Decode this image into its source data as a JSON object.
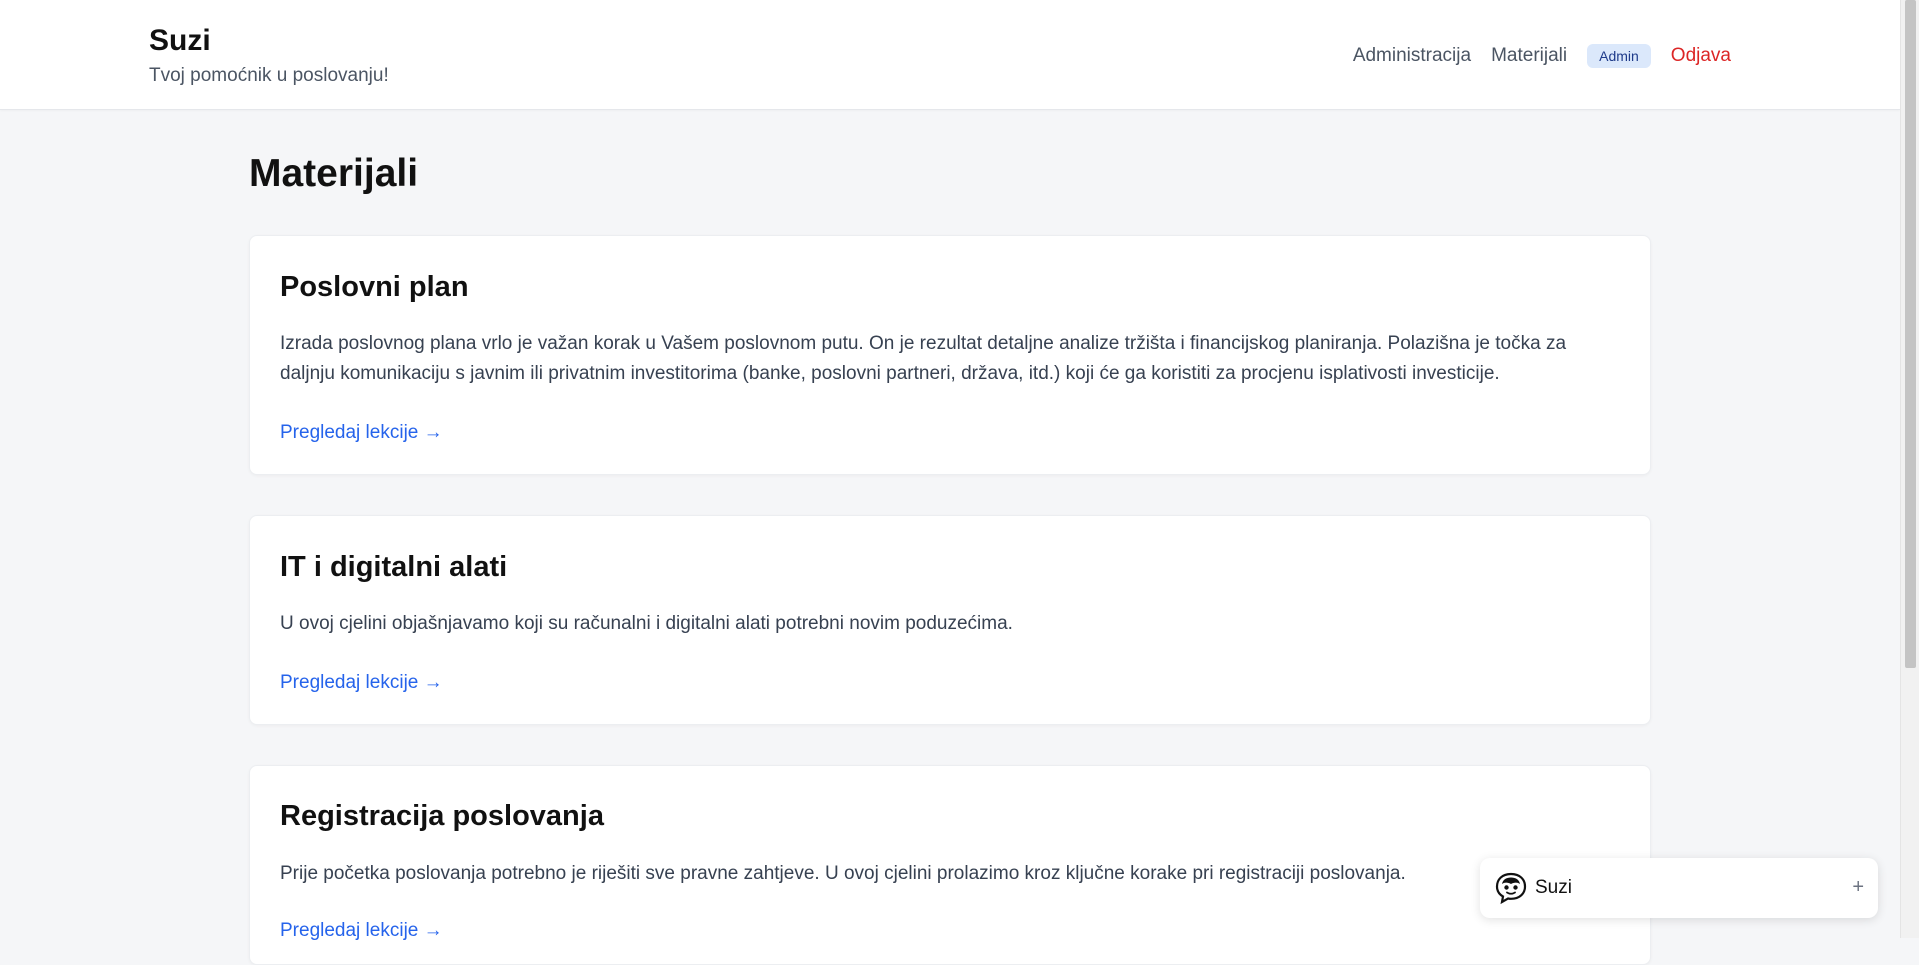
{
  "header": {
    "brand_title": "Suzi",
    "brand_tagline": "Tvoj pomoćnik u poslovanju!",
    "nav": {
      "administration": "Administracija",
      "materials": "Materijali",
      "role_badge": "Admin",
      "logout": "Odjava"
    }
  },
  "main": {
    "page_title": "Materijali",
    "cards": [
      {
        "title": "Poslovni plan",
        "description": "Izrada poslovnog plana vrlo je važan korak u Vašem poslovnom putu. On je rezultat detaljne analize tržišta i financijskog planiranja. Polazišna je točka za daljnju komunikaciju s javnim ili privatnim investitorima (banke, poslovni partneri, država, itd.) koji će ga koristiti za procjenu isplativosti investicije.",
        "link": "Pregledaj lekcije →"
      },
      {
        "title": "IT i digitalni alati",
        "description": "U ovoj cjelini objašnjavamo koji su računalni i digitalni alati potrebni novim poduzećima.",
        "link": "Pregledaj lekcije →"
      },
      {
        "title": "Registracija poslovanja",
        "description": "Prije početka poslovanja potrebno je riješiti sve pravne zahtjeve. U ovoj cjelini prolazimo kroz ključne korake pri registraciji poslovanja.",
        "link": "Pregledaj lekcije →"
      }
    ]
  },
  "chat_widget": {
    "name": "Suzi",
    "toggle": "+",
    "icon": "chat-assistant-icon"
  },
  "colors": {
    "accent_link": "#2563eb",
    "logout": "#dc2626",
    "badge_bg": "#dbe8fb",
    "page_bg": "#f5f6f8"
  }
}
